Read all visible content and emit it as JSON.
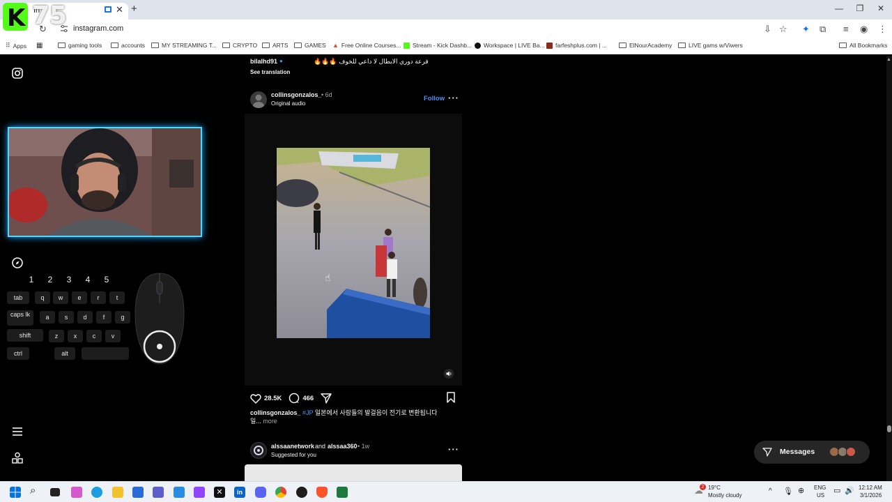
{
  "browser": {
    "tab_title": "In",
    "url": "instagram.com",
    "tab_close": "✕",
    "new_tab": "+",
    "window_controls": {
      "minimize": "—",
      "restore": "❐",
      "close": "✕"
    }
  },
  "bookmarks": [
    {
      "label": "Apps",
      "icon": "apps-grid-icon"
    },
    {
      "label": "",
      "icon": "grid-icon"
    },
    {
      "label": "gaming tools",
      "icon": "folder-icon"
    },
    {
      "label": "accounts",
      "icon": "folder-icon"
    },
    {
      "label": "MY STREAMING T...",
      "icon": "folder-icon"
    },
    {
      "label": "CRYPTO",
      "icon": "folder-icon"
    },
    {
      "label": "ARTS",
      "icon": "folder-icon"
    },
    {
      "label": "GAMES",
      "icon": "folder-icon"
    },
    {
      "label": "Free Online Courses...",
      "icon": "courses-favicon"
    },
    {
      "label": "Stream - Kick Dashb...",
      "icon": "kick-favicon"
    },
    {
      "label": "Workspace | LIVE Ba...",
      "icon": "workspace-favicon"
    },
    {
      "label": "farfeshplus.com | ...",
      "icon": "farfesh-favicon"
    },
    {
      "label": "ElNourAcademy",
      "icon": "folder-icon"
    },
    {
      "label": "LIVE gams w/Viwers",
      "icon": "folder-icon"
    }
  ],
  "all_bookmarks": "All Bookmarks",
  "feed": {
    "prev_post": {
      "username": "bilalhd91",
      "caption": "قرعة دوري الابطال لا داعي للخوف 🔥🔥🔥",
      "see_translation": "See translation"
    },
    "post": {
      "username": "collinsgonzalos_",
      "time": "• 6d",
      "audio": "Original audio",
      "follow": "Follow",
      "likes": "28.5K",
      "comments": "466",
      "caption_user": "collinsgonzalos_",
      "caption_hashtag": "#JP",
      "caption_text": "일본에서 사람들의 발걸음이 전기로 변환됩니다",
      "caption_line2": "일...",
      "more": "more"
    },
    "next_post": {
      "user1": "alssaanetwork",
      "and": "and",
      "user2": "alssaa360",
      "time": "• 1w",
      "sub": "Suggested for you"
    }
  },
  "messages": {
    "label": "Messages"
  },
  "overlay": {
    "k_letter": "K",
    "viewer_number": "75",
    "number_keys": [
      "1",
      "2",
      "3",
      "4",
      "5"
    ],
    "keys": {
      "tab": "tab",
      "q": "q",
      "w": "w",
      "e": "e",
      "r": "r",
      "t": "t",
      "caps": "caps lk",
      "a": "a",
      "s": "s",
      "d": "d",
      "f": "f",
      "g": "g",
      "shift": "shift",
      "z": "z",
      "x": "x",
      "c": "c",
      "v": "v",
      "ctrl": "ctrl",
      "alt": "alt"
    }
  },
  "taskbar": {
    "weather_temp": "19°C",
    "weather_desc": "Mostly cloudy",
    "weather_badge": "2",
    "lang": "ENG",
    "region": "US",
    "time": "12:12 AM",
    "date": "3/1/2026"
  },
  "colors": {
    "instagram_bg": "#000000",
    "link_blue": "#4f8ef7",
    "kick_green": "#53fc18",
    "webcam_glow": "#4fd8ff"
  }
}
